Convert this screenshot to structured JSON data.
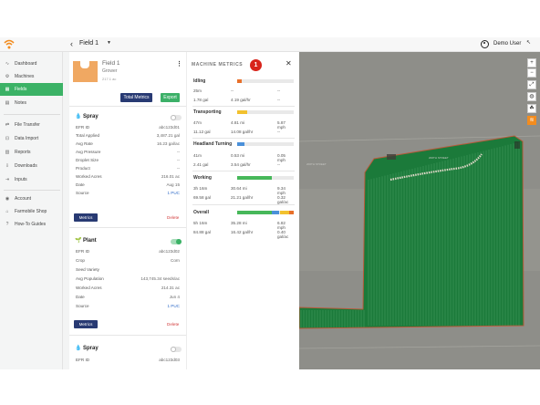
{
  "header": {
    "title": "Field 1",
    "user_name": "Demo User"
  },
  "sidebar": {
    "items": [
      {
        "label": "Dashboard",
        "icon": "dashboard-icon",
        "glyph": "∿"
      },
      {
        "label": "Machines",
        "icon": "machine-icon",
        "glyph": "⚙"
      },
      {
        "label": "Fields",
        "icon": "fields-icon",
        "glyph": "▦"
      },
      {
        "label": "Notes",
        "icon": "notes-icon",
        "glyph": "▤"
      },
      {
        "label": "File Transfer",
        "icon": "transfer-icon",
        "glyph": "⇄"
      },
      {
        "label": "Data Import",
        "icon": "import-icon",
        "glyph": "⊡"
      },
      {
        "label": "Reports",
        "icon": "reports-icon",
        "glyph": "▥"
      },
      {
        "label": "Downloads",
        "icon": "download-icon",
        "glyph": "⇩"
      },
      {
        "label": "Inputs",
        "icon": "inputs-icon",
        "glyph": "⇥"
      },
      {
        "label": "Account",
        "icon": "account-icon",
        "glyph": "◉"
      },
      {
        "label": "Farmobile Shop",
        "icon": "shop-icon",
        "glyph": "⌂"
      },
      {
        "label": "How-To Guides",
        "icon": "help-icon",
        "glyph": "?"
      }
    ]
  },
  "field_card": {
    "title": "Field 1",
    "grower": "Grower",
    "area": "217.1 ac",
    "total_metrics_label": "Total Metrics",
    "export_label": "Export"
  },
  "operations": [
    {
      "name": "Spray",
      "rows": [
        {
          "k": "EFR ID",
          "v": "abc123d01"
        },
        {
          "k": "Total Applied",
          "v": "3,487.21 gal"
        },
        {
          "k": "Avg Rate",
          "v": "16.23 gal/ac"
        },
        {
          "k": "Avg Pressure",
          "v": "--"
        },
        {
          "k": "Droplet Size",
          "v": "--"
        },
        {
          "k": "Product",
          "v": "--"
        },
        {
          "k": "Worked Acres",
          "v": "216.01 ac"
        },
        {
          "k": "Date",
          "v": "Aug 15"
        },
        {
          "k": "Source",
          "v": "1 PUC"
        }
      ],
      "metrics_label": "Metrics",
      "delete_label": "Delete"
    },
    {
      "name": "Plant",
      "rows": [
        {
          "k": "EFR ID",
          "v": "abc123d02"
        },
        {
          "k": "Crop",
          "v": "Corn"
        },
        {
          "k": "Seed Variety",
          "v": ""
        },
        {
          "k": "Avg Population",
          "v": "143,745.34 seeds/ac"
        },
        {
          "k": "Worked Acres",
          "v": "214.31 ac"
        },
        {
          "k": "Date",
          "v": "Jun 4"
        },
        {
          "k": "Source",
          "v": "1 PUC"
        }
      ],
      "metrics_label": "Metrics",
      "delete_label": "Delete"
    },
    {
      "name": "Spray",
      "rows": [
        {
          "k": "EFR ID",
          "v": "abc123d03"
        }
      ]
    }
  ],
  "machine_metrics": {
    "title": "MACHINE METRICS",
    "badge": "1",
    "sections": [
      {
        "name": "Idling",
        "color": "#e8702a",
        "fraction": 0.08,
        "rows": [
          [
            "25m",
            "--",
            "--"
          ],
          [
            "1.78 gal",
            "4.19 gal/hr",
            "--"
          ]
        ]
      },
      {
        "name": "Transporting",
        "color": "#f2c12e",
        "fraction": 0.18,
        "rows": [
          [
            "47m",
            "4.81 mi",
            "5.87 mph"
          ],
          [
            "11.12 gal",
            "14.08 gal/hr",
            "--"
          ]
        ]
      },
      {
        "name": "Headland Turning",
        "color": "#4a90d9",
        "fraction": 0.13,
        "rows": [
          [
            "41m",
            "0.53 mi",
            "0.05 mph"
          ],
          [
            "2.41 gal",
            "3.54 gal/hr",
            "--"
          ]
        ]
      },
      {
        "name": "Working",
        "color": "#47b85a",
        "fraction": 0.62,
        "rows": [
          [
            "3h 16m",
            "30.64 mi",
            "9.34 mph"
          ],
          [
            "69.58 gal",
            "21.21 gal/hr",
            "0.32 gal/ac"
          ]
        ]
      },
      {
        "name": "Overall",
        "color": "multi",
        "fraction": 1.0,
        "segments": [
          {
            "color": "#47b85a",
            "fraction": 0.62
          },
          {
            "color": "#4a90d9",
            "fraction": 0.13
          },
          {
            "color": "#f2c12e",
            "fraction": 0.17
          },
          {
            "color": "#e8702a",
            "fraction": 0.08
          }
        ],
        "rows": [
          [
            "5h 16m",
            "35.28 mi",
            "6.82 mph"
          ],
          [
            "84.88 gal",
            "16.42 gal/hr",
            "0.40 gal/ac"
          ]
        ]
      }
    ]
  },
  "map": {
    "road_labels": [
      "200TH STREET",
      "200TH STREET"
    ],
    "controls": [
      "+",
      "−",
      "⤢",
      "◍",
      "☘",
      "≋"
    ]
  },
  "colors": {
    "accent_green": "#3bb266",
    "navy": "#283a73",
    "crop_green": "#1b7a3a",
    "badge_red": "#d8241b"
  }
}
